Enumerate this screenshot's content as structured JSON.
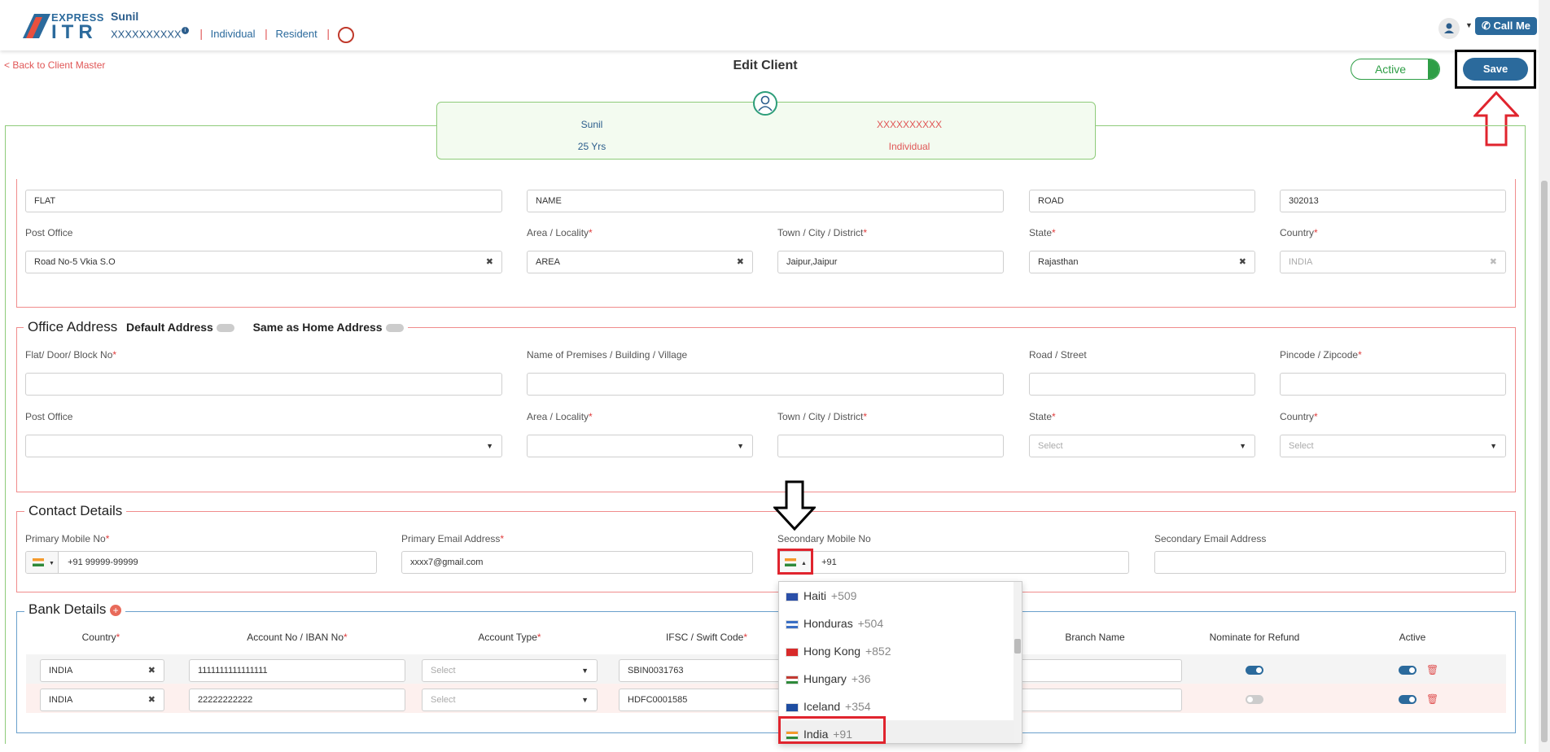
{
  "header": {
    "logo_top": "EXPRESS",
    "logo_main": "ITR",
    "user_name": "Sunil",
    "pan": "XXXXXXXXXX",
    "type": "Individual",
    "residency": "Resident",
    "call_me": "Call Me"
  },
  "page": {
    "back_link": "< Back to Client Master",
    "title": "Edit Client",
    "status": "Active",
    "save": "Save"
  },
  "summary": {
    "name": "Sunil",
    "age": "25 Yrs",
    "pan": "XXXXXXXXXX",
    "type": "Individual"
  },
  "home_address": {
    "flat": "FLAT",
    "premises": "NAME",
    "road": "ROAD",
    "pincode": "302013",
    "post_office_label": "Post Office",
    "post_office": "Road No-5 Vkia S.O",
    "area_label": "Area / Locality",
    "area": "AREA",
    "town_label": "Town / City / District",
    "town": "Jaipur,Jaipur",
    "state_label": "State",
    "state": "Rajasthan",
    "country_label": "Country",
    "country": "INDIA"
  },
  "office_address": {
    "title": "Office Address",
    "default_label": "Default Address",
    "same_as_home_label": "Same as Home Address",
    "flat_label": "Flat/ Door/ Block No",
    "premises_label": "Name of Premises / Building / Village",
    "road_label": "Road / Street",
    "pincode_label": "Pincode / Zipcode",
    "post_office_label": "Post Office",
    "area_label": "Area / Locality",
    "town_label": "Town / City / District",
    "state_label": "State",
    "state_placeholder": "Select",
    "country_label": "Country",
    "country_placeholder": "Select"
  },
  "contact": {
    "title": "Contact Details",
    "primary_mobile_label": "Primary Mobile No",
    "primary_mobile": "+91 99999-99999",
    "primary_email_label": "Primary Email Address",
    "primary_email": "xxxx7@gmail.com",
    "secondary_mobile_label": "Secondary Mobile No",
    "secondary_mobile": "+91",
    "secondary_email_label": "Secondary Email Address"
  },
  "bank": {
    "title": "Bank Details",
    "columns": [
      "Country",
      "Account No / IBAN No",
      "Account Type",
      "IFSC / Swift Code",
      "Branch Name",
      "Nominate for Refund",
      "Active"
    ],
    "rows": [
      {
        "country": "INDIA",
        "account": "1111111111111111",
        "type": "Select",
        "ifsc": "SBIN0031763",
        "nominate": true,
        "active": true
      },
      {
        "country": "INDIA",
        "account": "22222222222",
        "type": "Select",
        "ifsc": "HDFC0001585",
        "nominate": false,
        "active": true
      }
    ]
  },
  "country_dropdown": [
    {
      "name": "Haiti",
      "code": "+509",
      "flag_color": "#2b4fa8"
    },
    {
      "name": "Honduras",
      "code": "+504",
      "flag_color": "#3a6fc4"
    },
    {
      "name": "Hong Kong",
      "code": "+852",
      "flag_color": "#d82a2a"
    },
    {
      "name": "Hungary",
      "code": "+36",
      "flag_color": "#c23a32"
    },
    {
      "name": "Iceland",
      "code": "+354",
      "flag_color": "#1e4da1"
    },
    {
      "name": "India",
      "code": "+91",
      "flag_color": "#f49a2c"
    }
  ]
}
